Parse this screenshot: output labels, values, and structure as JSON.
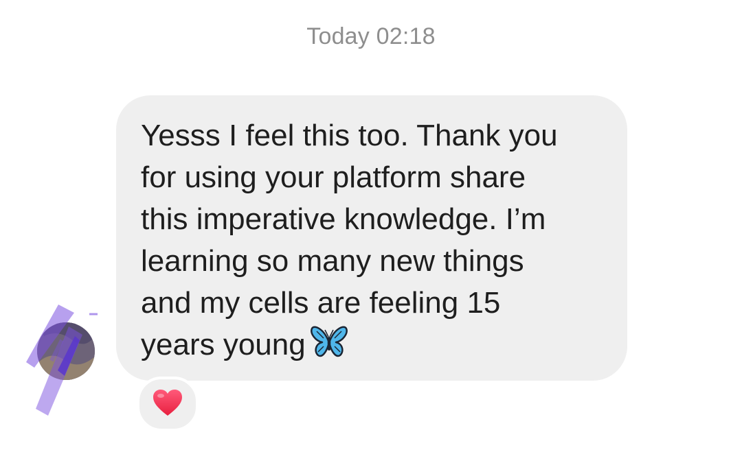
{
  "timestamp": "Today 02:18",
  "message": {
    "lines": [
      "Yesss I feel this too. Thank you",
      "for using your platform share",
      "this imperative knowledge. I’m",
      "learning so many new things",
      "and my cells are feeling 15",
      "years young"
    ],
    "emoji": "butterfly-icon"
  },
  "reaction": {
    "emoji": "heart-icon",
    "color": "#f0365a"
  },
  "colors": {
    "bubble": "#efefef",
    "text": "#1e1e1e",
    "timestamp": "#8e8e8e",
    "scribble": "#7b52e0"
  }
}
